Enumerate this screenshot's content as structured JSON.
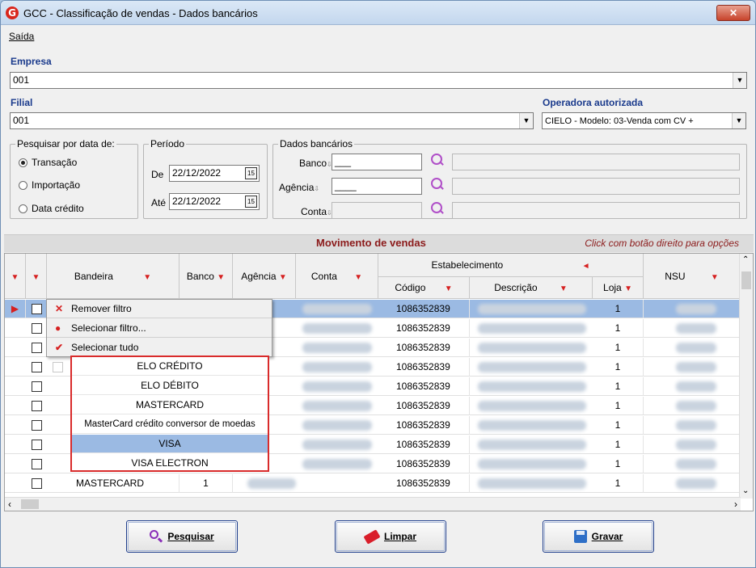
{
  "window": {
    "title": "GCC - Classificação de vendas - Dados bancários",
    "logo": "G",
    "close": "✕"
  },
  "menu": {
    "saida": "Saída"
  },
  "empresa": {
    "label": "Empresa",
    "value": "001"
  },
  "filial": {
    "label": "Filial",
    "value": "001"
  },
  "operadora": {
    "label": "Operadora autorizada",
    "value": "CIELO - Modelo: 03-Venda com CV +"
  },
  "pesquisar": {
    "title": "Pesquisar por data de:",
    "options": [
      "Transação",
      "Importação",
      "Data crédito"
    ],
    "selected": "Transação"
  },
  "periodo": {
    "title": "Período",
    "de_label": "De",
    "de_value": "22/12/2022",
    "ate_label": "Até",
    "ate_value": "22/12/2022",
    "cal_icon": "15"
  },
  "dados_bancarios": {
    "title": "Dados bancários",
    "banco_label": "Banco",
    "banco_value": "___",
    "agencia_label": "Agência",
    "agencia_value": "____",
    "conta_label": "Conta"
  },
  "grid_header": {
    "title": "Movimento de vendas",
    "hint": "Click com botão direito para opções"
  },
  "columns": {
    "bandeira": "Bandeira",
    "banco": "Banco",
    "agencia": "Agência",
    "conta": "Conta",
    "estabelecimento": "Estabelecimento",
    "codigo": "Código",
    "descricao": "Descrição",
    "loja": "Loja",
    "nsu": "NSU"
  },
  "rows": [
    {
      "codigo": "1086352839",
      "loja": "1"
    },
    {
      "codigo": "1086352839",
      "loja": "1"
    },
    {
      "codigo": "1086352839",
      "loja": "1"
    },
    {
      "codigo": "1086352839",
      "loja": "1"
    },
    {
      "codigo": "1086352839",
      "loja": "1"
    },
    {
      "codigo": "1086352839",
      "loja": "1"
    },
    {
      "codigo": "1086352839",
      "loja": "1"
    },
    {
      "codigo": "1086352839",
      "loja": "1"
    },
    {
      "codigo": "1086352839",
      "loja": "1"
    },
    {
      "codigo": "1086352839",
      "loja": "1",
      "bandeira": "MASTERCARD",
      "banco": "1"
    }
  ],
  "context_menu": [
    "Remover filtro",
    "Selecionar filtro...",
    "Selecionar tudo"
  ],
  "filter_list": {
    "items": [
      "ELO CRÉDITO",
      "ELO DÉBITO",
      "MASTERCARD",
      "MasterCard crédito conversor de moedas",
      "VISA",
      "VISA ELECTRON"
    ],
    "selected": "VISA"
  },
  "buttons": {
    "pesquisar": "Pesquisar",
    "limpar": "Limpar",
    "gravar": "Gravar"
  }
}
